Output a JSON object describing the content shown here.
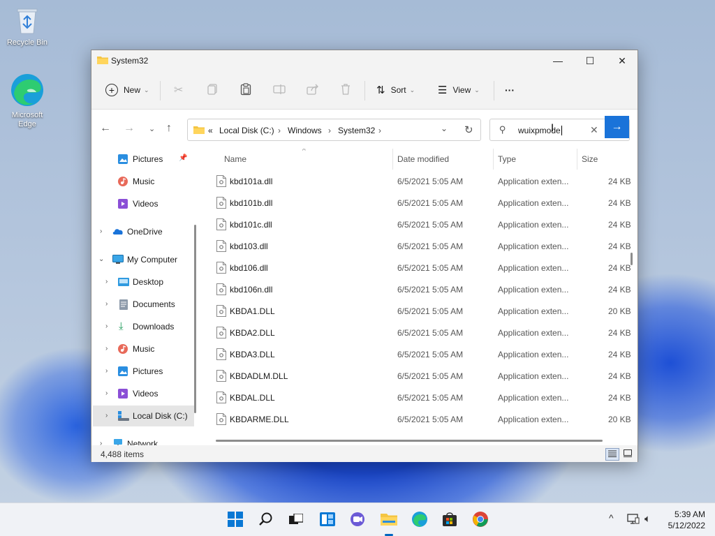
{
  "desktop": {
    "icons": [
      {
        "label": "Recycle Bin"
      },
      {
        "label": "Microsoft Edge"
      }
    ]
  },
  "window": {
    "title": "System32",
    "controls": {
      "minimize": "—",
      "maximize": "☐",
      "close": "✕"
    }
  },
  "toolbar": {
    "new_label": "New",
    "sort_label": "Sort",
    "view_label": "View",
    "more_label": "···"
  },
  "address": {
    "prefix": "«",
    "crumbs": [
      "Local Disk (C:)",
      "Windows",
      "System32"
    ],
    "separator": "›"
  },
  "search": {
    "value": "wuixpmode"
  },
  "sidebar": {
    "items": [
      {
        "label": "Pictures",
        "pinned": true
      },
      {
        "label": "Music"
      },
      {
        "label": "Videos"
      },
      {
        "label": "OneDrive"
      },
      {
        "label": "My Computer"
      },
      {
        "label": "Desktop"
      },
      {
        "label": "Documents"
      },
      {
        "label": "Downloads"
      },
      {
        "label": "Music"
      },
      {
        "label": "Pictures"
      },
      {
        "label": "Videos"
      },
      {
        "label": "Local Disk (C:)",
        "selected": true
      },
      {
        "label": "Network"
      }
    ]
  },
  "columns": {
    "name": "Name",
    "date": "Date modified",
    "type": "Type",
    "size": "Size"
  },
  "files": [
    {
      "name": "kbd101a.dll",
      "date": "6/5/2021 5:05 AM",
      "type": "Application exten...",
      "size": "24 KB"
    },
    {
      "name": "kbd101b.dll",
      "date": "6/5/2021 5:05 AM",
      "type": "Application exten...",
      "size": "24 KB"
    },
    {
      "name": "kbd101c.dll",
      "date": "6/5/2021 5:05 AM",
      "type": "Application exten...",
      "size": "24 KB"
    },
    {
      "name": "kbd103.dll",
      "date": "6/5/2021 5:05 AM",
      "type": "Application exten...",
      "size": "24 KB"
    },
    {
      "name": "kbd106.dll",
      "date": "6/5/2021 5:05 AM",
      "type": "Application exten...",
      "size": "24 KB"
    },
    {
      "name": "kbd106n.dll",
      "date": "6/5/2021 5:05 AM",
      "type": "Application exten...",
      "size": "24 KB"
    },
    {
      "name": "KBDA1.DLL",
      "date": "6/5/2021 5:05 AM",
      "type": "Application exten...",
      "size": "20 KB"
    },
    {
      "name": "KBDA2.DLL",
      "date": "6/5/2021 5:05 AM",
      "type": "Application exten...",
      "size": "24 KB"
    },
    {
      "name": "KBDA3.DLL",
      "date": "6/5/2021 5:05 AM",
      "type": "Application exten...",
      "size": "24 KB"
    },
    {
      "name": "KBDADLM.DLL",
      "date": "6/5/2021 5:05 AM",
      "type": "Application exten...",
      "size": "24 KB"
    },
    {
      "name": "KBDAL.DLL",
      "date": "6/5/2021 5:05 AM",
      "type": "Application exten...",
      "size": "24 KB"
    },
    {
      "name": "KBDARME.DLL",
      "date": "6/5/2021 5:05 AM",
      "type": "Application exten...",
      "size": "20 KB"
    }
  ],
  "status": {
    "item_count": "4,488 items"
  },
  "taskbar": {
    "time": "5:39 AM",
    "date": "5/12/2022"
  },
  "colors": {
    "accent": "#1a73d9",
    "folder": "#f4c542"
  }
}
